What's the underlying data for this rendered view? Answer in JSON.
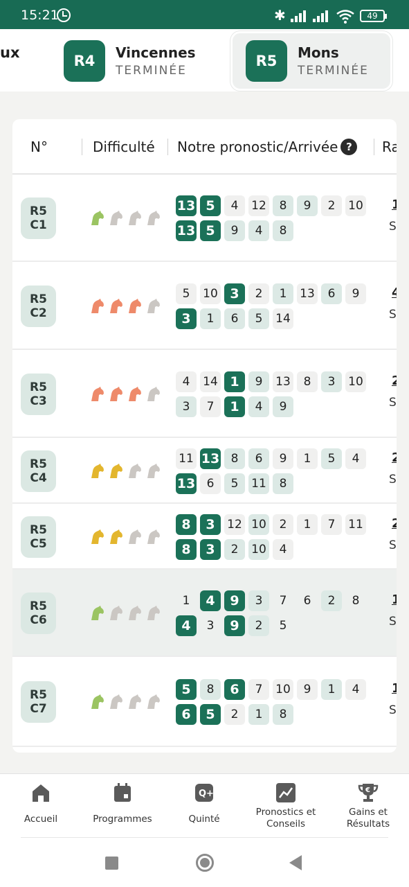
{
  "status_bar": {
    "time": "15:21",
    "battery": "49"
  },
  "race_tabs": {
    "partial_label": "ux",
    "tabs": [
      {
        "code": "R4",
        "name": "Vincennes",
        "status": "TERMINÉE"
      },
      {
        "code": "R5",
        "name": "Mons",
        "status": "TERMINÉE"
      }
    ]
  },
  "table": {
    "headers": {
      "no": "N°",
      "difficulty": "Difficulté",
      "prono": "Notre pronostic/Arrivée",
      "rapport": "Ra"
    },
    "rows": [
      {
        "race": "R5",
        "course": "C1",
        "difficulty": 1,
        "diff_color": "#9bc462",
        "prono": [
          13,
          5,
          4,
          12,
          8,
          9,
          2,
          10
        ],
        "prono_styles": [
          "d",
          "d",
          "g",
          "g",
          "t",
          "t",
          "g",
          "g"
        ],
        "arrivee": [
          13,
          5,
          9,
          4,
          8
        ],
        "arrivee_styles": [
          "d",
          "d",
          "t",
          "t",
          "t"
        ],
        "rap_top": "1",
        "rap_bot": "S"
      },
      {
        "race": "R5",
        "course": "C2",
        "difficulty": 3,
        "diff_color": "#ee8a6a",
        "prono": [
          5,
          10,
          3,
          2,
          1,
          13,
          6,
          9
        ],
        "prono_styles": [
          "g",
          "g",
          "d",
          "g",
          "t",
          "g",
          "t",
          "g"
        ],
        "arrivee": [
          3,
          1,
          6,
          5,
          14
        ],
        "arrivee_styles": [
          "d",
          "t",
          "t",
          "t",
          "g"
        ],
        "rap_top": "4",
        "rap_bot": "S"
      },
      {
        "race": "R5",
        "course": "C3",
        "difficulty": 3,
        "diff_color": "#ee8a6a",
        "prono": [
          4,
          14,
          1,
          9,
          13,
          8,
          3,
          10
        ],
        "prono_styles": [
          "g",
          "g",
          "d",
          "t",
          "g",
          "g",
          "t",
          "g"
        ],
        "arrivee": [
          3,
          7,
          1,
          4,
          9
        ],
        "arrivee_styles": [
          "t",
          "g",
          "d",
          "t",
          "t"
        ],
        "rap_top": "2",
        "rap_bot": "S"
      },
      {
        "race": "R5",
        "course": "C4",
        "difficulty": 2,
        "diff_color": "#e3b62e",
        "prono": [
          11,
          13,
          8,
          6,
          9,
          1,
          5,
          4
        ],
        "prono_styles": [
          "g",
          "d",
          "t",
          "t",
          "g",
          "g",
          "t",
          "g"
        ],
        "arrivee": [
          13,
          6,
          5,
          11,
          8
        ],
        "arrivee_styles": [
          "d",
          "g",
          "t",
          "t",
          "t"
        ],
        "rap_top": "2",
        "rap_bot": "S"
      },
      {
        "race": "R5",
        "course": "C5",
        "difficulty": 2,
        "diff_color": "#e3b62e",
        "prono": [
          8,
          3,
          12,
          10,
          2,
          1,
          7,
          11
        ],
        "prono_styles": [
          "d",
          "d",
          "g",
          "t",
          "g",
          "g",
          "g",
          "g"
        ],
        "arrivee": [
          8,
          3,
          2,
          10,
          4
        ],
        "arrivee_styles": [
          "d",
          "d",
          "t",
          "t",
          "g"
        ],
        "rap_top": "2",
        "rap_bot": "S"
      },
      {
        "race": "R5",
        "course": "C6",
        "difficulty": 1,
        "diff_color": "#9bc462",
        "prono": [
          1,
          4,
          9,
          3,
          7,
          6,
          2,
          8
        ],
        "prono_styles": [
          "w",
          "d",
          "d",
          "t",
          "w",
          "w",
          "t",
          "w"
        ],
        "arrivee": [
          4,
          3,
          9,
          2,
          5
        ],
        "arrivee_styles": [
          "d",
          "w",
          "d",
          "t",
          "w"
        ],
        "rap_top": "1",
        "rap_bot": "S"
      },
      {
        "race": "R5",
        "course": "C7",
        "difficulty": 1,
        "diff_color": "#9bc462",
        "prono": [
          5,
          8,
          6,
          7,
          10,
          9,
          1,
          4
        ],
        "prono_styles": [
          "d",
          "t",
          "d",
          "g",
          "g",
          "g",
          "t",
          "g"
        ],
        "arrivee": [
          6,
          5,
          2,
          1,
          8
        ],
        "arrivee_styles": [
          "d",
          "d",
          "g",
          "t",
          "t"
        ],
        "rap_top": "1",
        "rap_bot": "S"
      }
    ]
  },
  "bottom_nav": [
    {
      "label": "Accueil",
      "icon": "home-icon"
    },
    {
      "label": "Programmes",
      "icon": "calendar-icon"
    },
    {
      "label": "Quinté",
      "icon": "quinte-icon"
    },
    {
      "label": "Pronostics et Conseils",
      "icon": "chart-icon"
    },
    {
      "label": "Gains et Résultats",
      "icon": "trophy-icon"
    }
  ]
}
